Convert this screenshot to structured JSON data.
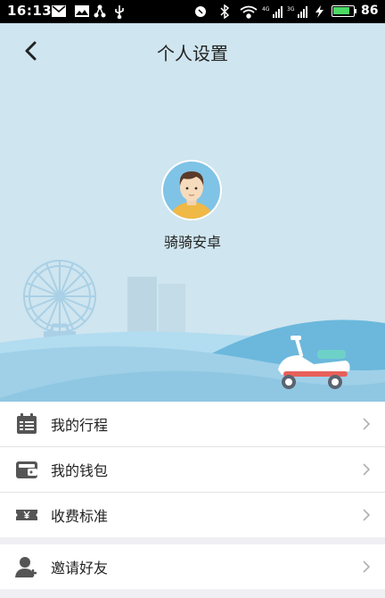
{
  "status_bar": {
    "time": "16:13",
    "battery_level": "86",
    "battery_percent": 0.86,
    "network_badge_1": "4G",
    "network_badge_2": "3G"
  },
  "header": {
    "title": "个人设置",
    "back_icon": "chevron-left-icon"
  },
  "profile": {
    "name": "骑骑安卓",
    "avatar_icon": "user-avatar"
  },
  "menu_groups": [
    {
      "items": [
        {
          "label": "我的行程",
          "icon": "calendar-icon"
        },
        {
          "label": "我的钱包",
          "icon": "wallet-icon"
        },
        {
          "label": "收费标准",
          "icon": "ticket-yuan-icon"
        }
      ]
    },
    {
      "items": [
        {
          "label": "邀请好友",
          "icon": "add-user-icon"
        }
      ]
    }
  ],
  "colors": {
    "hero_sky": "#cfe5ef",
    "hill": "#9fd0e8",
    "icon_gray": "#555555",
    "arrow_gray": "#b0b0b0"
  }
}
